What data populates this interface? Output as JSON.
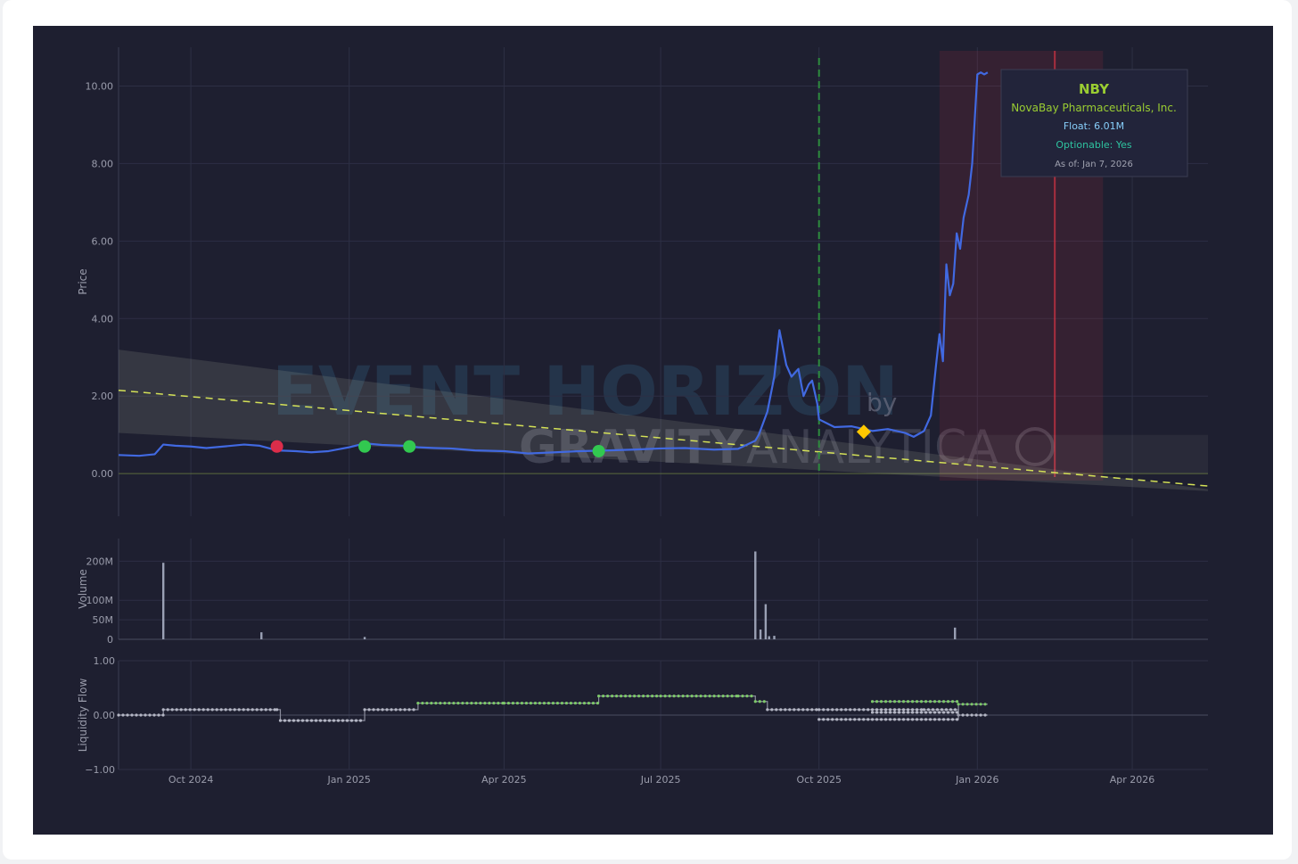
{
  "watermark": {
    "title": "EVENT HORIZON",
    "by": "by",
    "brand_a": "GRAVITY",
    "brand_b": "ANALYTICA"
  },
  "info_box": {
    "ticker": "NBY",
    "company": "NovaBay Pharmaceuticals, Inc.",
    "float": "Float: 6.01M",
    "optionable": "Optionable: Yes",
    "as_of": "As of: Jan 7, 2026"
  },
  "colors": {
    "background": "#1e1f30",
    "price_line": "#4169e1",
    "trend_line": "#d4e157",
    "event_line": "#2e8b3e",
    "danger_zone": "#dc3545",
    "marker_red": "#dc2d4a",
    "marker_green": "#32c850",
    "marker_diamond": "#ffc800",
    "ticker": "#9acd32",
    "float": "#87cefa",
    "optionable": "#2ec4a0"
  },
  "chart_data": [
    {
      "type": "line",
      "panel": "price",
      "ylabel": "Price",
      "ylim": [
        -1.1,
        11.0
      ],
      "yticks": [
        "0.00",
        "2.00",
        "4.00",
        "6.00",
        "8.00",
        "10.00"
      ],
      "xticks": [
        "Oct 2024",
        "Jan 2025",
        "Apr 2025",
        "Jul 2025",
        "Oct 2025",
        "Jan 2026",
        "Apr 2026"
      ],
      "grid": true,
      "series": [
        {
          "x": [
            "2024-08-20",
            "2024-09-01",
            "2024-09-10",
            "2024-09-15",
            "2024-09-22",
            "2024-10-01",
            "2024-10-10",
            "2024-10-20",
            "2024-11-01",
            "2024-11-10",
            "2024-11-20",
            "2024-12-01",
            "2024-12-10",
            "2024-12-20",
            "2025-01-01",
            "2025-01-10",
            "2025-01-20",
            "2025-02-01",
            "2025-02-10",
            "2025-02-20",
            "2025-03-01",
            "2025-03-15",
            "2025-04-01",
            "2025-04-15",
            "2025-05-01",
            "2025-05-15",
            "2025-06-01",
            "2025-06-15",
            "2025-07-01",
            "2025-07-15",
            "2025-08-01",
            "2025-08-15",
            "2025-08-25",
            "2025-08-27",
            "2025-09-01",
            "2025-09-05",
            "2025-09-08",
            "2025-09-12",
            "2025-09-15",
            "2025-09-19",
            "2025-09-22",
            "2025-09-25",
            "2025-09-27",
            "2025-09-30",
            "2025-10-01",
            "2025-10-10",
            "2025-10-20",
            "2025-11-01",
            "2025-11-10",
            "2025-11-20",
            "2025-11-25",
            "2025-12-01",
            "2025-12-05",
            "2025-12-08",
            "2025-12-10",
            "2025-12-12",
            "2025-12-14",
            "2025-12-16",
            "2025-12-18",
            "2025-12-20",
            "2025-12-22",
            "2025-12-24",
            "2025-12-27",
            "2025-12-29",
            "2026-01-01",
            "2026-01-03",
            "2026-01-05",
            "2026-01-07"
          ],
          "y": [
            0.48,
            0.46,
            0.5,
            0.75,
            0.72,
            0.7,
            0.66,
            0.7,
            0.75,
            0.72,
            0.6,
            0.58,
            0.55,
            0.58,
            0.68,
            0.78,
            0.74,
            0.72,
            0.68,
            0.66,
            0.65,
            0.6,
            0.58,
            0.52,
            0.55,
            0.58,
            0.6,
            0.62,
            0.65,
            0.66,
            0.62,
            0.64,
            0.85,
            1.0,
            1.6,
            2.5,
            3.7,
            2.8,
            2.5,
            2.7,
            2.0,
            2.3,
            2.4,
            1.8,
            1.4,
            1.2,
            1.22,
            1.1,
            1.15,
            1.05,
            0.95,
            1.1,
            1.5,
            2.8,
            3.6,
            2.9,
            5.4,
            4.6,
            4.9,
            6.2,
            5.8,
            6.6,
            7.2,
            8.0,
            10.3,
            10.35,
            10.3,
            10.35
          ]
        }
      ],
      "trend_line": {
        "x": [
          "2024-08-20",
          "2026-05-15"
        ],
        "y": [
          2.15,
          -0.32
        ]
      },
      "trend_band": {
        "x": [
          "2024-08-20",
          "2026-05-15"
        ],
        "upper": [
          3.2,
          -0.4
        ],
        "lower": [
          1.05,
          -0.45
        ]
      },
      "event_line_date": "2025-10-01",
      "danger_zone": {
        "start": "2025-12-10",
        "end": "2026-03-15",
        "line": "2026-02-15"
      },
      "markers": [
        {
          "x": "2024-11-20",
          "y": 0.7,
          "type": "sell"
        },
        {
          "x": "2025-01-10",
          "y": 0.7,
          "type": "buy"
        },
        {
          "x": "2025-02-05",
          "y": 0.7,
          "type": "buy"
        },
        {
          "x": "2025-05-26",
          "y": 0.58,
          "type": "buy"
        },
        {
          "x": "2025-10-27",
          "y": 1.08,
          "type": "event"
        }
      ]
    },
    {
      "type": "bar",
      "panel": "volume",
      "ylabel": "Volume",
      "ylim": [
        0,
        240
      ],
      "yticks": [
        "0",
        "50M",
        "100M",
        "200M"
      ],
      "series": [
        {
          "name": "",
          "x": [
            "2024-09-15",
            "2024-11-11",
            "2025-01-10",
            "2025-08-25",
            "2025-08-28",
            "2025-08-31",
            "2025-09-02",
            "2025-09-05",
            "2025-12-19"
          ],
          "values": [
            196,
            18,
            6,
            225,
            25,
            90,
            8,
            9,
            30
          ]
        }
      ],
      "baseline_note": ""
    },
    {
      "type": "line",
      "panel": "liquidity",
      "ylabel": "Liquidity Flow",
      "ylim": [
        -1.0,
        1.0
      ],
      "yticks": [
        "−1.00",
        "0.00",
        "1.00"
      ],
      "series": [
        {
          "name": "",
          "x": [
            "2024-08-20",
            "2024-09-15",
            "2024-11-20",
            "2024-11-22",
            "2025-01-10",
            "2025-02-10",
            "2025-04-01",
            "2025-05-26",
            "2025-07-01",
            "2025-08-15",
            "2025-08-25",
            "2025-09-01",
            "2025-10-01",
            "2025-11-01",
            "2025-12-01",
            "2025-12-21",
            "2026-01-07"
          ],
          "values": [
            0.0,
            0.1,
            0.1,
            -0.1,
            0.1,
            0.22,
            0.22,
            0.35,
            0.35,
            0.35,
            0.25,
            0.1,
            0.1,
            0.1,
            0.1,
            0.0,
            0.0
          ]
        },
        {
          "name": "",
          "x": [
            "2025-10-01",
            "2025-11-01",
            "2025-12-21",
            "2026-01-07"
          ],
          "values": [
            -0.08,
            -0.08,
            0.2,
            0.2
          ]
        },
        {
          "name": "",
          "x": [
            "2025-11-01",
            "2025-12-21"
          ],
          "values": [
            0.25,
            0.25
          ]
        },
        {
          "name": "",
          "x": [
            "2025-11-01",
            "2025-12-21"
          ],
          "values": [
            0.05,
            0.05
          ]
        }
      ]
    }
  ]
}
